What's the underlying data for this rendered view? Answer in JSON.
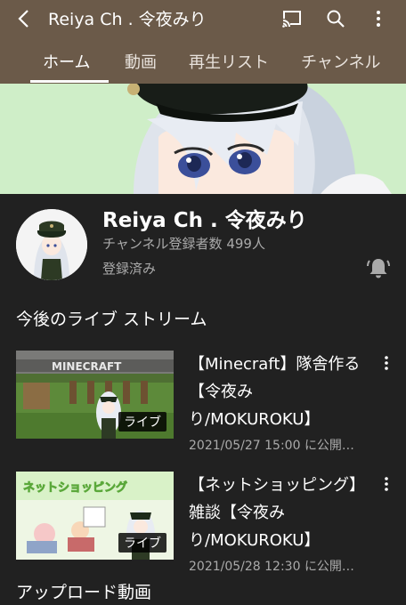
{
  "header": {
    "title": "Reiya Ch . 令夜みり",
    "icons": [
      "back-arrow-icon",
      "cast-icon",
      "search-icon",
      "more-vert-icon"
    ]
  },
  "tabs": [
    {
      "label": "ホーム",
      "active": true
    },
    {
      "label": "動画"
    },
    {
      "label": "再生リスト"
    },
    {
      "label": "チャンネル"
    }
  ],
  "channel": {
    "name": "Reiya Ch . 令夜みり",
    "subscribers": "チャンネル登録者数 499人",
    "subscribed_label": "登録済み"
  },
  "sections": {
    "upcoming_title": "今後のライブ ストリーム",
    "uploads_title": "アップロード動画"
  },
  "videos": [
    {
      "title": "【Minecraft】隊舎作る【令夜みり/MOKUROKU】",
      "meta": "2021/05/27 15:00 に公開…",
      "badge": "ライブ",
      "thumb_text": "MINECRAFT"
    },
    {
      "title": "【ネットショッピング】雑談【令夜みり/MOKUROKU】",
      "meta": "2021/05/28 12:30 に公開…",
      "badge": "ライブ",
      "thumb_text": "ネットショッピング"
    }
  ],
  "colors": {
    "appbar": "#6b5a49",
    "background": "#212121",
    "banner": "#cfeec8",
    "secondary_text": "#aaaaaa"
  }
}
